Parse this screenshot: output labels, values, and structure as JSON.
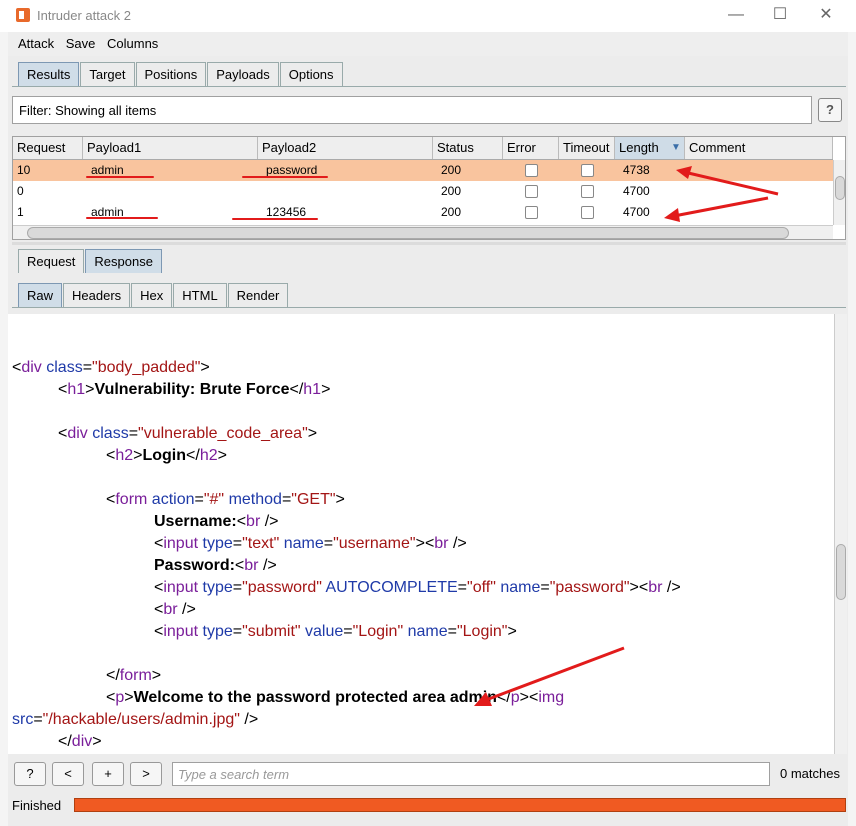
{
  "window": {
    "title": "Intruder attack 2",
    "minimize": "—",
    "maximize": "☐",
    "close": "✕"
  },
  "menu": [
    "Attack",
    "Save",
    "Columns"
  ],
  "main_tabs": [
    "Results",
    "Target",
    "Positions",
    "Payloads",
    "Options"
  ],
  "filter": {
    "text": "Filter: Showing all items",
    "help": "?"
  },
  "results": {
    "columns": [
      "Request",
      "Payload1",
      "Payload2",
      "Status",
      "Error",
      "Timeout",
      "Length",
      "Comment"
    ],
    "sort_indicator": "▼",
    "rows": [
      {
        "request": "10",
        "payload1": "admin",
        "payload2": "password",
        "status": "200",
        "length": "4738",
        "selected": true
      },
      {
        "request": "0",
        "payload1": "",
        "payload2": "",
        "status": "200",
        "length": "4700",
        "selected": false
      },
      {
        "request": "1",
        "payload1": "admin",
        "payload2": "123456",
        "status": "200",
        "length": "4700",
        "selected": false
      }
    ]
  },
  "detail_tabs": [
    "Request",
    "Response"
  ],
  "view_tabs": [
    "Raw",
    "Headers",
    "Hex",
    "HTML",
    "Render"
  ],
  "bottom": {
    "help": "?",
    "prev": "<",
    "add": "+",
    "next": ">",
    "search_placeholder": "Type a search term",
    "matches": "0 matches"
  },
  "status": {
    "text": "Finished",
    "progress": 1.0
  },
  "colors": {
    "selected_row": "#f9c49e",
    "progress": "#f05a22",
    "annotation": "#e21b1b"
  }
}
